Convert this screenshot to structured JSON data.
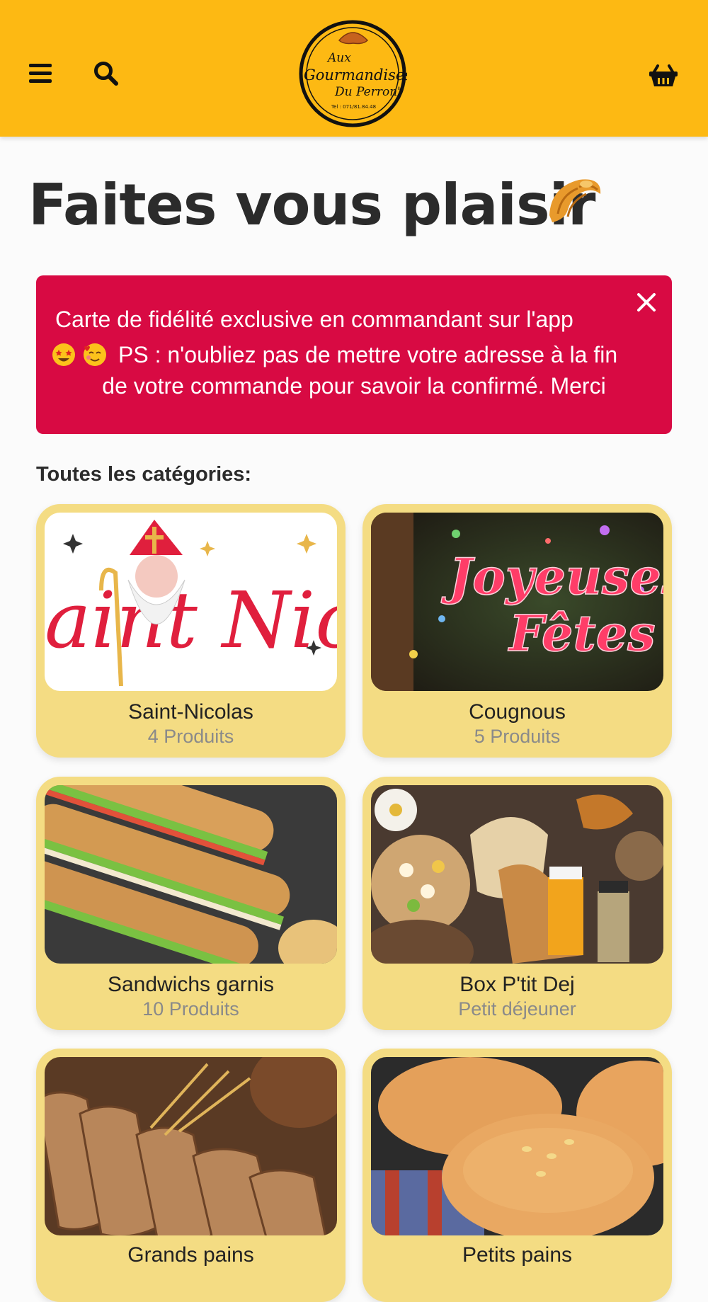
{
  "header": {
    "brand": "Aux Gourmandises Du Perron",
    "logo_text_1": "Aux",
    "logo_text_2": "Gourmandises",
    "logo_text_3": "Du Perron'",
    "logo_phone": "Tel : 071/81.84.48",
    "bar_color": "#fdb913"
  },
  "page": {
    "title": "Faites vous plaisir",
    "title_icon": "croissant-icon"
  },
  "alert": {
    "line1": "Carte de fidélité exclusive en commandant sur l'app",
    "line2": "PS : n'oubliez pas de mettre votre adresse à la fin",
    "line3": "de votre commande pour savoir la confirmé. Merci",
    "emojis": [
      "star-struck-face-icon",
      "smiling-face-with-hearts-icon"
    ],
    "color": "#d80a43"
  },
  "categories": {
    "heading": "Toutes les catégories:",
    "items": [
      {
        "name": "Saint-Nicolas",
        "subtitle": "4 Produits",
        "image_text": "aint Nico"
      },
      {
        "name": "Cougnous",
        "subtitle": "5 Produits",
        "image_text_1": "Joyeuses",
        "image_text_2": "Fêtes"
      },
      {
        "name": "Sandwichs garnis",
        "subtitle": "10 Produits"
      },
      {
        "name": "Box P'tit Dej",
        "subtitle": "Petit déjeuner"
      },
      {
        "name": "Grands pains",
        "subtitle": ""
      },
      {
        "name": "Petits pains",
        "subtitle": ""
      }
    ],
    "card_color": "#f4dc83"
  }
}
